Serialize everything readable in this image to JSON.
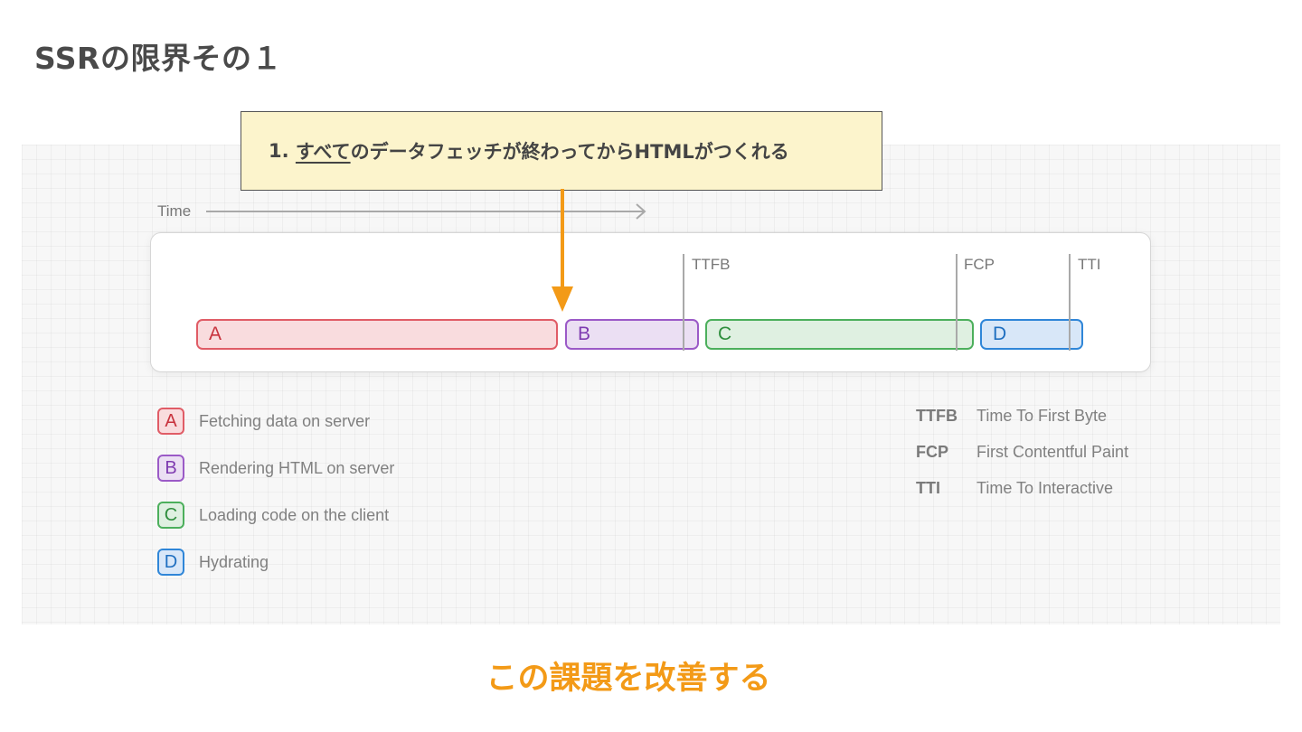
{
  "slide": {
    "title": "SSRの限界その１",
    "footer": "この課題を改善する"
  },
  "callout": {
    "prefix": "1. ",
    "emphasis": "すべて",
    "rest": "のデータフェッチが終わってからHTMLがつくれる"
  },
  "timeline": {
    "time_label": "Time",
    "bars": [
      {
        "key": "A",
        "color": "#e05c66"
      },
      {
        "key": "B",
        "color": "#9b5ac7"
      },
      {
        "key": "C",
        "color": "#4caf5c"
      },
      {
        "key": "D",
        "color": "#2f86d8"
      }
    ],
    "markers": [
      "TTFB",
      "FCP",
      "TTI"
    ]
  },
  "legend": [
    {
      "key": "A",
      "text": "Fetching data on server"
    },
    {
      "key": "B",
      "text": "Rendering HTML on server"
    },
    {
      "key": "C",
      "text": "Loading code on the client"
    },
    {
      "key": "D",
      "text": "Hydrating"
    }
  ],
  "metrics": [
    {
      "abbr": "TTFB",
      "desc": "Time To First Byte"
    },
    {
      "abbr": "FCP",
      "desc": "First Contentful Paint"
    },
    {
      "abbr": "TTI",
      "desc": "Time To Interactive"
    }
  ],
  "colors": {
    "accent": "#f39a17",
    "callout_bg": "#fcf4cc"
  }
}
